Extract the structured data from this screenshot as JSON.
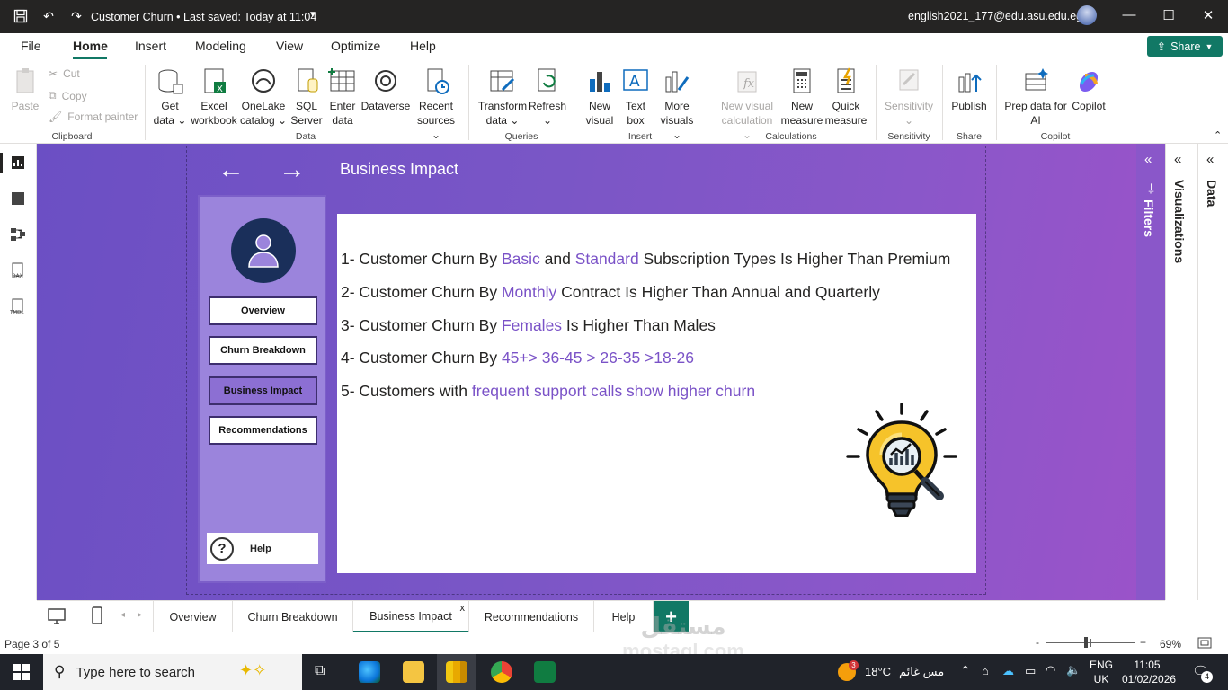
{
  "titlebar": {
    "title": "Customer Churn • Last saved: Today at 11:04",
    "account": "english2021_177@edu.asu.edu.eg"
  },
  "menu": {
    "items": [
      "File",
      "Home",
      "Insert",
      "Modeling",
      "View",
      "Optimize",
      "Help"
    ],
    "active": "Home",
    "share_label": "Share"
  },
  "ribbon": {
    "clipboard": {
      "paste": "Paste",
      "cut": "Cut",
      "copy": "Copy",
      "format_painter": "Format painter",
      "group": "Clipboard"
    },
    "data": {
      "get_data": [
        "Get",
        "data"
      ],
      "excel": [
        "Excel",
        "workbook"
      ],
      "onelake": [
        "OneLake",
        "catalog"
      ],
      "sql": [
        "SQL",
        "Server"
      ],
      "enter": [
        "Enter",
        "data"
      ],
      "dataverse": "Dataverse",
      "recent": [
        "Recent",
        "sources"
      ],
      "group": "Data"
    },
    "queries": {
      "transform": [
        "Transform",
        "data"
      ],
      "refresh": "Refresh",
      "group": "Queries"
    },
    "insert": {
      "new_visual": [
        "New",
        "visual"
      ],
      "text_box": [
        "Text",
        "box"
      ],
      "more_visuals": [
        "More",
        "visuals"
      ],
      "group": "Insert"
    },
    "calculations": {
      "new_visual_calc": [
        "New visual",
        "calculation"
      ],
      "new_measure": [
        "New",
        "measure"
      ],
      "quick_measure": [
        "Quick",
        "measure"
      ],
      "group": "Calculations"
    },
    "sensitivity": {
      "label": "Sensitivity",
      "group": "Sensitivity"
    },
    "share": {
      "publish": "Publish",
      "group": "Share"
    },
    "copilot": {
      "prep": [
        "Prep data for",
        "AI"
      ],
      "copilot": "Copilot",
      "group": "Copilot"
    }
  },
  "report": {
    "page_title": "Business Impact",
    "nav_buttons": [
      "Overview",
      "Churn Breakdown",
      "Business Impact",
      "Recommendations"
    ],
    "selected_nav": "Business Impact",
    "help_label": "Help",
    "insights": [
      {
        "parts": [
          {
            "t": "1- Customer Churn By ",
            "h": false
          },
          {
            "t": "Basic",
            "h": true
          },
          {
            "t": " and ",
            "h": false
          },
          {
            "t": "Standard",
            "h": true
          },
          {
            "t": " Subscription Types Is Higher Than Premium",
            "h": false
          }
        ]
      },
      {
        "parts": [
          {
            "t": "2- Customer Churn By ",
            "h": false
          },
          {
            "t": "Monthly",
            "h": true
          },
          {
            "t": " Contract Is Higher Than Annual and Quarterly",
            "h": false
          }
        ]
      },
      {
        "parts": [
          {
            "t": "3- Customer Churn By ",
            "h": false
          },
          {
            "t": "Females",
            "h": true
          },
          {
            "t": " Is Higher Than Males",
            "h": false
          }
        ]
      },
      {
        "parts": [
          {
            "t": "4- Customer Churn By ",
            "h": false
          },
          {
            "t": "45+> 36-45 > 26-35 >18-26",
            "h": true
          }
        ]
      },
      {
        "parts": [
          {
            "t": "5- Customers with ",
            "h": false
          },
          {
            "t": "frequent support calls show higher churn",
            "h": true
          }
        ]
      }
    ]
  },
  "panes": {
    "filters": "Filters",
    "visualizations": "Visualizations",
    "data": "Data"
  },
  "tabs": {
    "pages": [
      "Overview",
      "Churn Breakdown",
      "Business Impact",
      "Recommendations",
      "Help"
    ],
    "active": "Business Impact",
    "close_mark": "x",
    "add_mark": "+"
  },
  "status": {
    "page": "Page 3 of 5",
    "zoom": "69%",
    "zoom_minus": "-",
    "zoom_plus": "+",
    "zoom_fraction": 0.45
  },
  "taskbar": {
    "search_placeholder": "Type here to search",
    "weather_temp": "18°C",
    "weather_text": "مس غائم",
    "weather_badge": "3",
    "lang": "ENG",
    "region": "UK",
    "time": "11:05",
    "date": "01/02/2026",
    "notifications": "4"
  },
  "watermark": {
    "arabic": "مستقل",
    "latin": "mostaql.com"
  },
  "colors": {
    "accent": "#117865",
    "highlight": "#7a52c7",
    "canvas": "#7a56c6"
  }
}
